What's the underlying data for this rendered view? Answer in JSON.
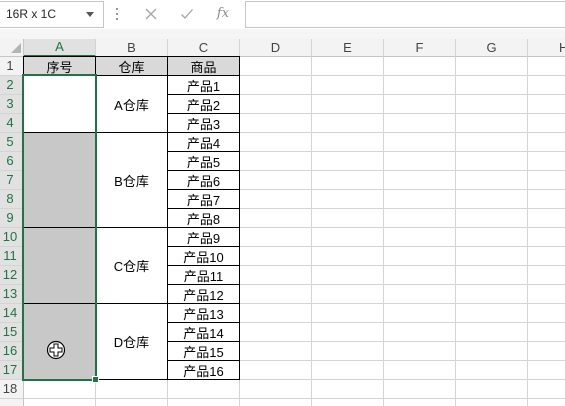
{
  "formula_bar": {
    "name_box_value": "16R x 1C",
    "name_box_dropdown_icon": "chevron-down-icon",
    "resize_handle_icon": "vertical-ellipsis-icon",
    "cancel_icon": "close-icon",
    "enter_icon": "check-icon",
    "insert_function_label": "fx"
  },
  "sheet": {
    "select_all_icon": "triangle-corner-icon",
    "columns": [
      "A",
      "B",
      "C",
      "D",
      "E",
      "F",
      "G",
      "H"
    ],
    "rows": [
      "1",
      "2",
      "3",
      "4",
      "5",
      "6",
      "7",
      "8",
      "9",
      "10",
      "11",
      "12",
      "13",
      "14",
      "15",
      "16",
      "17",
      "18"
    ],
    "colors": {
      "accent": "#217346",
      "gridline": "#d4d4d4",
      "header_background": "#f3f3f3",
      "selected_header_background": "#e1e1e1",
      "selection_fill": "#c8c8c8",
      "table_header_fill": "#d9d9d9",
      "table_border": "#000000"
    }
  },
  "table": {
    "headers": [
      "序号",
      "仓库",
      "商品"
    ],
    "groups": [
      {
        "warehouse": "A仓库",
        "products": [
          "产品1",
          "产品2",
          "产品3"
        ]
      },
      {
        "warehouse": "B仓库",
        "products": [
          "产品4",
          "产品5",
          "产品6",
          "产品7",
          "产品8"
        ]
      },
      {
        "warehouse": "C仓库",
        "products": [
          "产品9",
          "产品10",
          "产品11",
          "产品12"
        ]
      },
      {
        "warehouse": "D仓库",
        "products": [
          "产品13",
          "产品14",
          "产品15",
          "产品16"
        ]
      }
    ]
  },
  "cursor": {
    "icon": "cell-select-cursor-icon"
  }
}
